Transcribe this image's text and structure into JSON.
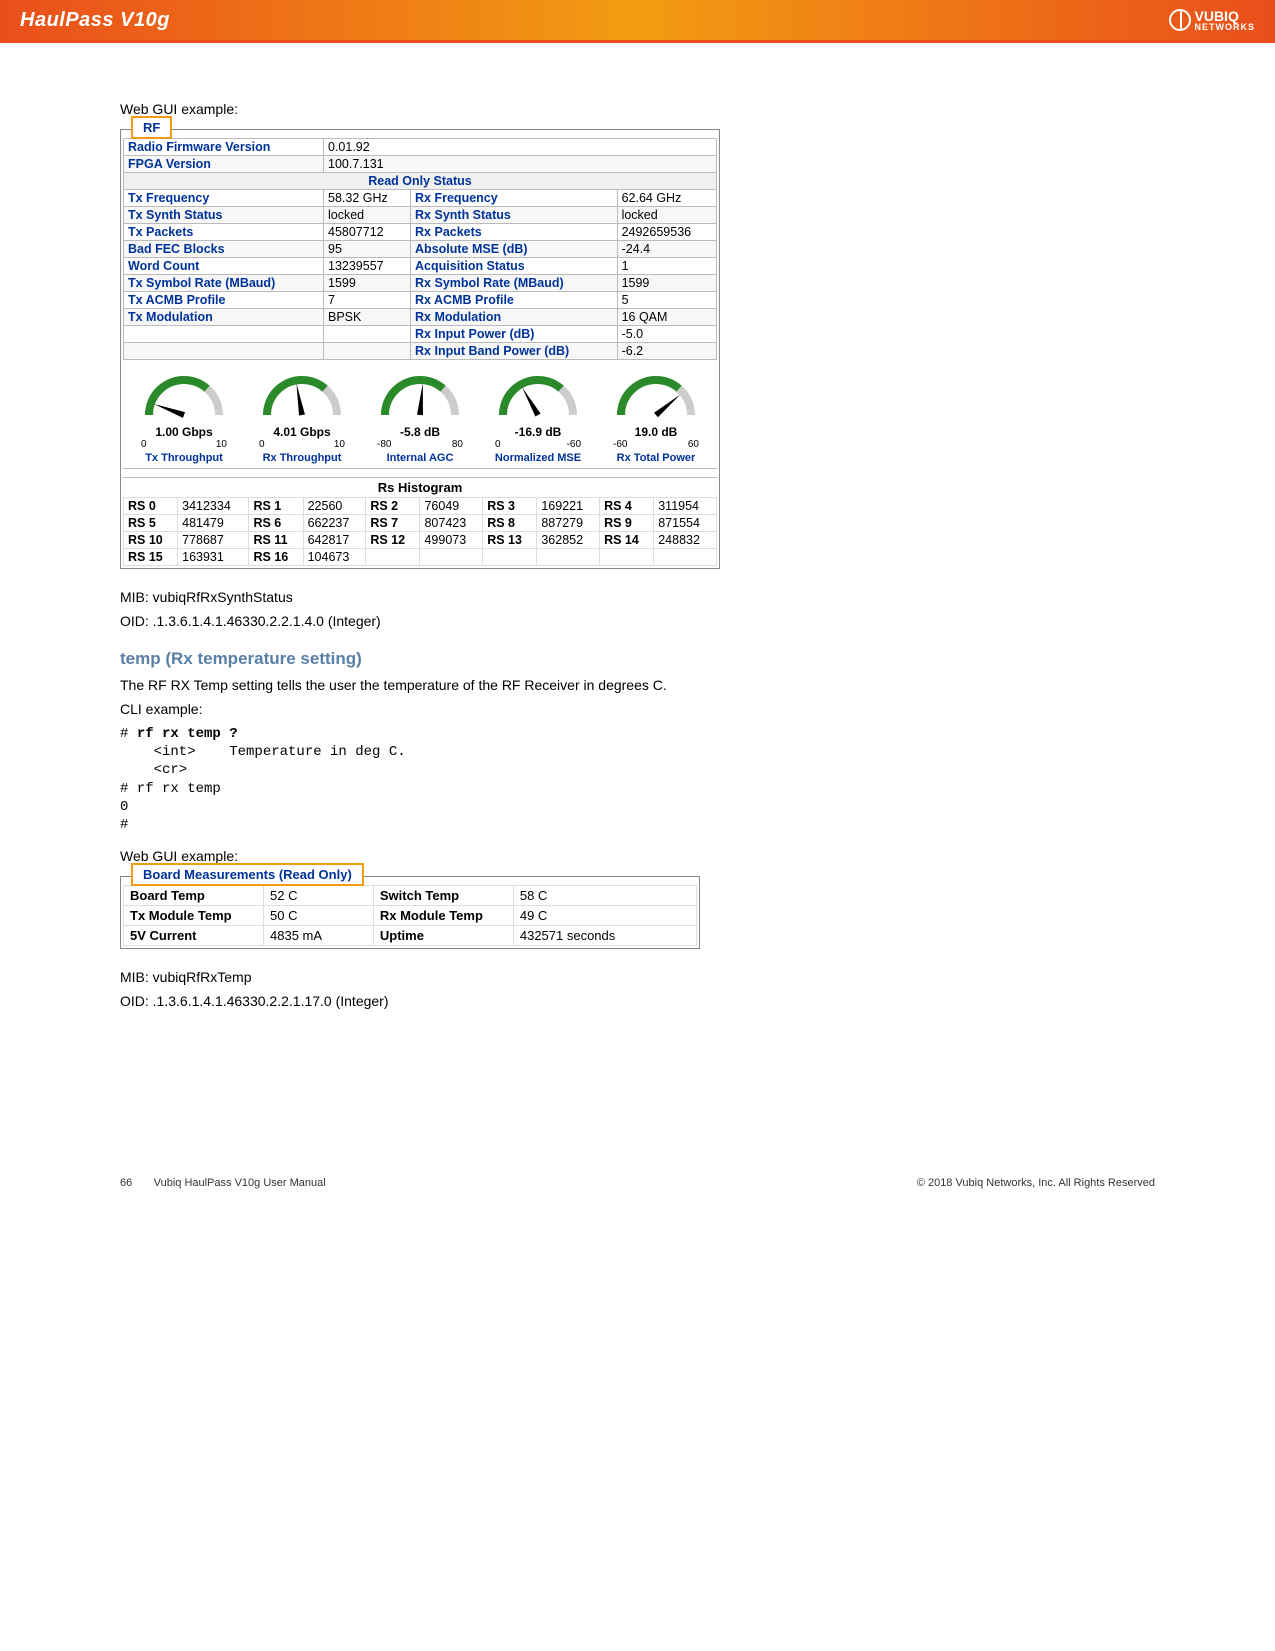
{
  "header": {
    "title": "HaulPass V10g",
    "logo_main": "VUBIQ",
    "logo_sub": "NETWORKS"
  },
  "intro": {
    "webGuiLabel": "Web GUI example:"
  },
  "rf": {
    "tab": "RF",
    "firmwareLabel": "Radio Firmware Version",
    "firmwareVal": "0.01.92",
    "fpgaLabel": "FPGA Version",
    "fpgaVal": "100.7.131",
    "readOnlyStatus": "Read Only Status",
    "rows": [
      [
        "Tx Frequency",
        "58.32 GHz",
        "Rx Frequency",
        "62.64 GHz"
      ],
      [
        "Tx Synth Status",
        "locked",
        "Rx Synth Status",
        "locked"
      ],
      [
        "Tx Packets",
        "45807712",
        "Rx Packets",
        "2492659536"
      ],
      [
        "Bad FEC Blocks",
        "95",
        "Absolute MSE (dB)",
        "-24.4"
      ],
      [
        "Word Count",
        "13239557",
        "Acquisition Status",
        "1"
      ],
      [
        "Tx Symbol Rate (MBaud)",
        "1599",
        "Rx Symbol Rate (MBaud)",
        "1599"
      ],
      [
        "Tx ACMB Profile",
        "7",
        "Rx ACMB Profile",
        "5"
      ],
      [
        "Tx Modulation",
        "BPSK",
        "Rx Modulation",
        "16 QAM"
      ],
      [
        "",
        "",
        "Rx Input Power (dB)",
        "-5.0"
      ],
      [
        "",
        "",
        "Rx Input Band Power (dB)",
        "-6.2"
      ]
    ],
    "gauges": [
      {
        "val": "1.00 Gbps",
        "min": "0",
        "max": "10",
        "lbl": "Tx Throughput"
      },
      {
        "val": "4.01 Gbps",
        "min": "0",
        "max": "10",
        "lbl": "Rx Throughput"
      },
      {
        "val": "-5.8 dB",
        "min": "-80",
        "max": "80",
        "lbl": "Internal AGC"
      },
      {
        "val": "-16.9 dB",
        "min": "0",
        "max": "-60",
        "lbl": "Normalized MSE"
      },
      {
        "val": "19.0 dB",
        "min": "-60",
        "max": "60",
        "lbl": "Rx Total Power"
      }
    ],
    "histoTitle": "Rs Histogram",
    "rs": [
      [
        "RS 0",
        "3412334",
        "RS 1",
        "22560",
        "RS 2",
        "76049",
        "RS 3",
        "169221",
        "RS 4",
        "311954"
      ],
      [
        "RS 5",
        "481479",
        "RS 6",
        "662237",
        "RS 7",
        "807423",
        "RS 8",
        "887279",
        "RS 9",
        "871554"
      ],
      [
        "RS 10",
        "778687",
        "RS 11",
        "642817",
        "RS 12",
        "499073",
        "RS 13",
        "362852",
        "RS 14",
        "248832"
      ],
      [
        "RS 15",
        "163931",
        "RS 16",
        "104673",
        "",
        "",
        "",
        "",
        "",
        ""
      ]
    ]
  },
  "mib1": "MIB: vubiqRfRxSynthStatus",
  "oid1": "OID: .1.3.6.1.4.1.46330.2.2.1.4.0 (Integer)",
  "sectionTitle": "temp (Rx temperature setting)",
  "sectionDesc": "The RF RX Temp setting tells the user the temperature of the RF Receiver in degrees C.",
  "cliLabel": "CLI example:",
  "cli": {
    "l1a": "# ",
    "l1b": "rf rx temp ?",
    "l2": "    <int>    Temperature in deg C.",
    "l3": "    <cr>",
    "l4": "# rf rx temp",
    "l5": "0",
    "l6": "#"
  },
  "webGui2": "Web GUI example:",
  "bm": {
    "tab": "Board Measurements (Read Only)",
    "rows": [
      [
        "Board Temp",
        "52 C",
        "Switch Temp",
        "58 C"
      ],
      [
        "Tx Module Temp",
        "50 C",
        "Rx Module Temp",
        "49 C"
      ],
      [
        "5V Current",
        "4835 mA",
        "Uptime",
        "432571 seconds"
      ]
    ]
  },
  "mib2": "MIB:  vubiqRfRxTemp",
  "oid2": "OID:  .1.3.6.1.4.1.46330.2.2.1.17.0 (Integer)",
  "footer": {
    "page": "66",
    "manual": "Vubiq HaulPass V10g User Manual",
    "copyright": "© 2018 Vubiq Networks, Inc. All Rights Reserved"
  }
}
